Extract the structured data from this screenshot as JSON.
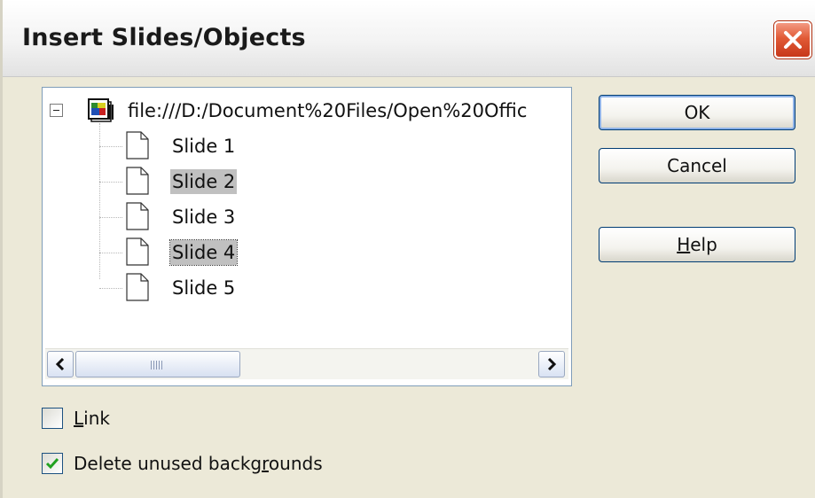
{
  "window": {
    "title": "Insert Slides/Objects"
  },
  "tree": {
    "root_label": "file:///D:/Document%20Files/Open%20Offic",
    "items": [
      {
        "label": "Slide 1",
        "state": "normal"
      },
      {
        "label": "Slide 2",
        "state": "selected"
      },
      {
        "label": "Slide 3",
        "state": "normal"
      },
      {
        "label": "Slide 4",
        "state": "focused"
      },
      {
        "label": "Slide 5",
        "state": "normal"
      }
    ]
  },
  "buttons": {
    "ok": "OK",
    "cancel": "Cancel",
    "help_mnemonic": "H",
    "help_rest": "elp"
  },
  "options": {
    "link_mnemonic": "L",
    "link_rest": "ink",
    "link_checked": false,
    "delete_prefix": "Delete unused backg",
    "delete_mnemonic": "r",
    "delete_suffix": "ounds",
    "delete_checked": true
  },
  "colors": {
    "selection": "#c0c0c0",
    "close_button": "#e15a36",
    "check_mark": "#21a121"
  }
}
